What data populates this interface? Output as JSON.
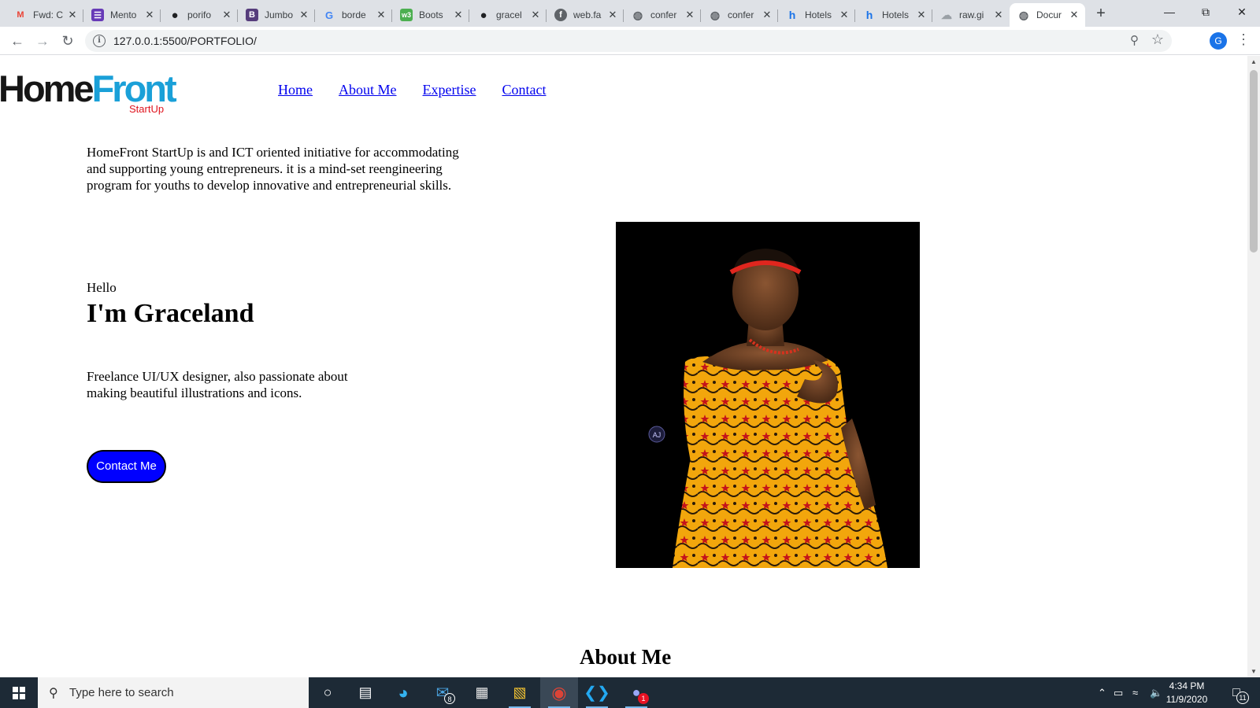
{
  "browser": {
    "tabs": [
      {
        "label": "Fwd: C",
        "icon": "gmail-icon",
        "fav": "M",
        "favcolor": "#ea4335",
        "favbg": "transparent"
      },
      {
        "label": "Mento",
        "icon": "forms-icon",
        "fav": "☰",
        "favcolor": "#ffffff",
        "favbg": "#673ab7"
      },
      {
        "label": "porifo",
        "icon": "github-icon",
        "fav": "●",
        "favcolor": "#202124",
        "favbg": "transparent"
      },
      {
        "label": "Jumbo",
        "icon": "bootstrap-icon",
        "fav": "B",
        "favcolor": "#ffffff",
        "favbg": "#563d7c"
      },
      {
        "label": "borde",
        "icon": "google-icon",
        "fav": "G",
        "favcolor": "#4285f4",
        "favbg": "transparent"
      },
      {
        "label": "Boots",
        "icon": "w3schools-icon",
        "fav": "w3",
        "favcolor": "#ffffff",
        "favbg": "#4caf50"
      },
      {
        "label": "gracel",
        "icon": "github-icon",
        "fav": "●",
        "favcolor": "#202124",
        "favbg": "transparent"
      },
      {
        "label": "web.fa",
        "icon": "facebook-icon",
        "fav": "f",
        "favcolor": "#ffffff",
        "favbg": "#5f6368"
      },
      {
        "label": "confer",
        "icon": "globe-icon",
        "fav": "◍",
        "favcolor": "#5f6368",
        "favbg": "transparent"
      },
      {
        "label": "confer",
        "icon": "globe-icon",
        "fav": "◍",
        "favcolor": "#5f6368",
        "favbg": "transparent"
      },
      {
        "label": "Hotels",
        "icon": "hotels-icon",
        "fav": "h",
        "favcolor": "#1a73e8",
        "favbg": "transparent"
      },
      {
        "label": "Hotels",
        "icon": "hotels-icon",
        "fav": "h",
        "favcolor": "#1a73e8",
        "favbg": "transparent"
      },
      {
        "label": "raw.gi",
        "icon": "cloud-icon",
        "fav": "☁",
        "favcolor": "#9aa0a6",
        "favbg": "transparent"
      },
      {
        "label": "Docur",
        "icon": "globe-icon",
        "fav": "◍",
        "favcolor": "#5f6368",
        "favbg": "transparent",
        "active": true
      }
    ],
    "url": "127.0.0.1:5500/PORTFOLIO/",
    "profile_initial": "G"
  },
  "page": {
    "logo": {
      "home": "Home",
      "front": "Front",
      "sub": "StartUp"
    },
    "nav": [
      "Home",
      "About Me",
      "Expertise",
      "Contact"
    ],
    "intro": "HomeFront StartUp is and ICT oriented initiative for accommodating and supporting young entrepreneurs. it is a mind-set reengineering program for youths to develop innovative and entrepreneurial skills.",
    "hello": "Hello",
    "name": "I'm Graceland",
    "bio": "Freelance UI/UX designer, also passionate about making beautiful illustrations and icons.",
    "contact_button": "Contact Me",
    "about_heading": "About Me",
    "portrait_watermark": "AJ"
  },
  "taskbar": {
    "search_placeholder": "Type here to search",
    "mail_badge": "8",
    "discord_badge": "1",
    "time": "4:34 PM",
    "date": "11/9/2020",
    "notification_count": "11"
  },
  "colors": {
    "link": "#0000ee",
    "button": "#0000ff",
    "logo_blue": "#1aa0d8",
    "logo_red": "#e0141e",
    "taskbar": "#1d2a36"
  }
}
